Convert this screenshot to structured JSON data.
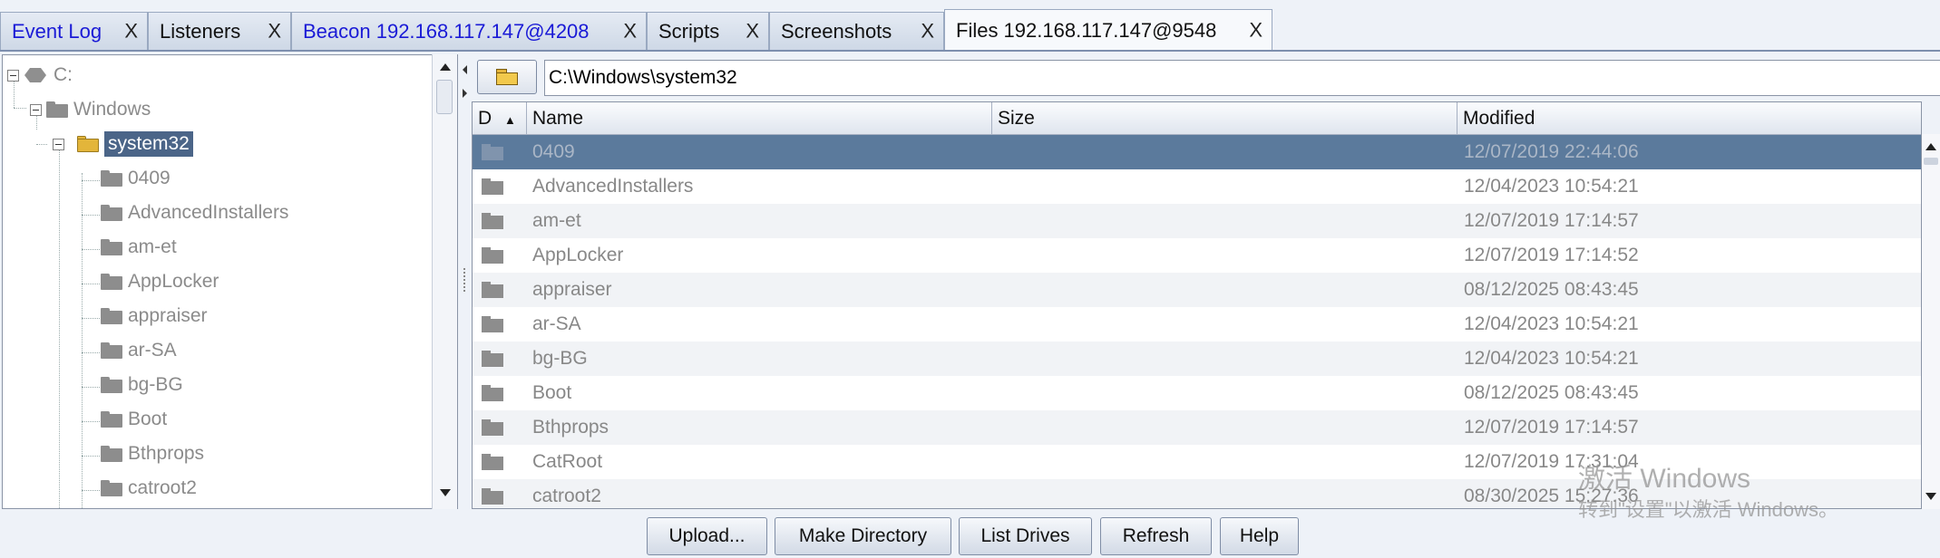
{
  "tabs": [
    {
      "label": "Event Log",
      "close": "X",
      "color": "#1a1ad6"
    },
    {
      "label": "Listeners",
      "close": "X",
      "color": "#111111"
    },
    {
      "label": "Beacon 192.168.117.147@4208",
      "close": "X",
      "color": "#1a1ad6"
    },
    {
      "label": "Scripts",
      "close": "X",
      "color": "#111111"
    },
    {
      "label": "Screenshots",
      "close": "X",
      "color": "#111111"
    },
    {
      "label": "Files 192.168.117.147@9548",
      "close": "X",
      "color": "#111111",
      "active": true
    }
  ],
  "tree": {
    "drive": "C:",
    "parent": "Windows",
    "current": "system32",
    "children": [
      "0409",
      "AdvancedInstallers",
      "am-et",
      "AppLocker",
      "appraiser",
      "ar-SA",
      "bg-BG",
      "Boot",
      "Bthprops",
      "catroot2"
    ]
  },
  "path": "C:\\Windows\\system32",
  "table": {
    "columns": {
      "d": "D",
      "name": "Name",
      "size": "Size",
      "modified": "Modified"
    },
    "sort_indicator": "▲",
    "rows": [
      {
        "name": "0409",
        "size": "",
        "modified": "12/07/2019 22:44:06",
        "selected": true
      },
      {
        "name": "AdvancedInstallers",
        "size": "",
        "modified": "12/04/2023 10:54:21"
      },
      {
        "name": "am-et",
        "size": "",
        "modified": "12/07/2019 17:14:57"
      },
      {
        "name": "AppLocker",
        "size": "",
        "modified": "12/07/2019 17:14:52"
      },
      {
        "name": "appraiser",
        "size": "",
        "modified": "08/12/2025 08:43:45"
      },
      {
        "name": "ar-SA",
        "size": "",
        "modified": "12/04/2023 10:54:21"
      },
      {
        "name": "bg-BG",
        "size": "",
        "modified": "12/04/2023 10:54:21"
      },
      {
        "name": "Boot",
        "size": "",
        "modified": "08/12/2025 08:43:45"
      },
      {
        "name": "Bthprops",
        "size": "",
        "modified": "12/07/2019 17:14:57"
      },
      {
        "name": "CatRoot",
        "size": "",
        "modified": "12/07/2019 17:31:04"
      },
      {
        "name": "catroot2",
        "size": "",
        "modified": "08/30/2025 15:27:36"
      }
    ]
  },
  "watermark": {
    "line1": "激活 Windows",
    "line2": "转到\"设置\"以激活 Windows。"
  },
  "buttons": {
    "upload": "Upload...",
    "make_directory": "Make Directory",
    "list_drives": "List Drives",
    "refresh": "Refresh",
    "help": "Help"
  }
}
